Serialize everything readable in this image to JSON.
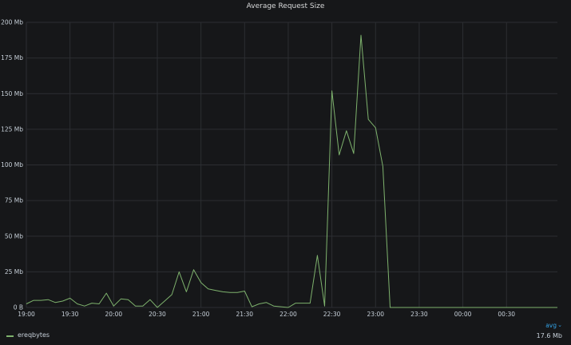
{
  "chart_data": {
    "type": "line",
    "title": "Average Request Size",
    "xlabel": "",
    "ylabel": "",
    "ylim": [
      0,
      200
    ],
    "y_ticks": [
      "0 B",
      "25 Mb",
      "50 Mb",
      "75 Mb",
      "100 Mb",
      "125 Mb",
      "150 Mb",
      "175 Mb",
      "200 Mb"
    ],
    "x_ticks": [
      "19:00",
      "19:30",
      "20:00",
      "20:30",
      "21:00",
      "21:30",
      "22:00",
      "22:30",
      "23:00",
      "23:30",
      "00:00",
      "00:30"
    ],
    "x_range_minutes_from_1900": [
      0,
      365
    ],
    "grid": true,
    "series": [
      {
        "name": "ereqbytes",
        "color": "#7eb26d",
        "x": [
          "19:00",
          "19:05",
          "19:10",
          "19:15",
          "19:20",
          "19:25",
          "19:30",
          "19:35",
          "19:40",
          "19:45",
          "19:50",
          "19:55",
          "20:00",
          "20:05",
          "20:10",
          "20:15",
          "20:20",
          "20:25",
          "20:30",
          "20:35",
          "20:40",
          "20:45",
          "20:50",
          "20:55",
          "21:00",
          "21:05",
          "21:10",
          "21:15",
          "21:20",
          "21:25",
          "21:30",
          "21:35",
          "21:40",
          "21:45",
          "21:50",
          "21:55",
          "22:00",
          "22:05",
          "22:10",
          "22:15",
          "22:20",
          "22:25",
          "22:30",
          "22:35",
          "22:40",
          "22:45",
          "22:50",
          "22:55",
          "23:00",
          "23:05",
          "23:10",
          "23:30",
          "00:00",
          "00:30",
          "01:05"
        ],
        "values": [
          2.5,
          5,
          5,
          5.5,
          3.5,
          4.5,
          6.5,
          2.5,
          1,
          3,
          2.5,
          10,
          1,
          6,
          5.5,
          1,
          1,
          5.5,
          0,
          4.5,
          9,
          25,
          11,
          26.5,
          17.5,
          13,
          12,
          11,
          10.5,
          10.5,
          11.5,
          0.5,
          2.5,
          3.5,
          1,
          0.5,
          0,
          3,
          3,
          3,
          36.5,
          1,
          152,
          107,
          124,
          108,
          191,
          132,
          126,
          99,
          0,
          0,
          0,
          0,
          0
        ]
      }
    ]
  },
  "legend": {
    "stat_header": "avg",
    "chevron": "⌄",
    "items": [
      {
        "name": "ereqbytes",
        "value": "17.6 Mb",
        "color": "#7eb26d"
      }
    ]
  }
}
